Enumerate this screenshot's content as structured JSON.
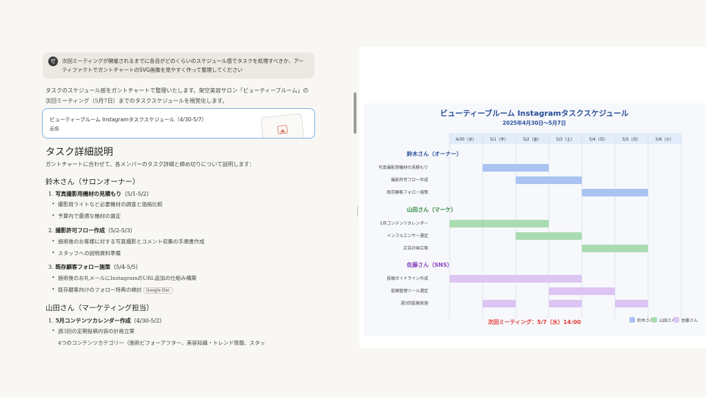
{
  "chat": {
    "user_avatar": "せ",
    "user_message": "次回ミーティングが開催されるまでに各自がどのくらいのスケジュール感でタスクを処理すべきか、アーティファクトでガントチャートのSVG画像を見やすく作って整理してください",
    "intro": "タスクのスケジュール感をガントチャートで整理いたします。架空美容サロン「ビューティーブルーム」の次回ミーティング（5月7日）までのタスクスケジュールを視覚化します。",
    "artifact_title": "ビューティーブルーム Instagramタスクスケジュール（4/30-5/7）",
    "artifact_type": "画像",
    "heading": "タスク詳細説明",
    "lead": "ガントチャートに合わせて、各メンバーのタスク詳細と締め切りについて説明します：",
    "sections": [
      {
        "title": "鈴木さん（サロンオーナー）",
        "tasks": [
          {
            "num": "1.",
            "name": "写真撮影用機材の見積もり",
            "period": "（5/1-5/2）",
            "bullets": [
              "撮影用ライトなど必要機材の調査と価格比較",
              "予算内で最適な機材の選定"
            ]
          },
          {
            "num": "2.",
            "name": "撮影許可フロー作成",
            "period": "（5/2-5/3）",
            "bullets": [
              "施術後のお客様に対する写真撮影とコメント収集の手順書作成",
              "スタッフへの説明資料準備"
            ]
          },
          {
            "num": "3.",
            "name": "既存顧客フォロー施策",
            "period": "（5/4-5/5）",
            "bullets": [
              "施術後のお礼メールにInstagramのURL追加の仕組み構築",
              "既存顧客向けのフォロー特典の検討"
            ]
          }
        ]
      },
      {
        "title": "山田さん（マーケティング担当）",
        "tasks": [
          {
            "num": "1.",
            "name": "5月コンテンツカレンダー作成",
            "period": "（4/30-5/2）",
            "bullets": [
              "週3回の定期投稿内容の計画立案",
              "4つのコンテンツカテゴリー（施術ビフォーアフター、美容知識・トレンド情報、スタッ"
            ]
          }
        ]
      }
    ],
    "google_doc_tag": "Google Doc"
  },
  "chart_data": {
    "type": "gantt",
    "title": "ビューティーブルーム Instagramタスクスケジュール",
    "subtitle": "2025年4月30日〜5月7日",
    "days": [
      "4/30（水）",
      "5/1（木）",
      "5/2（金）",
      "5/3（土）",
      "5/4（日）",
      "5/5（月）",
      "5/6（火）"
    ],
    "groups": [
      {
        "name": "鈴木さん（オーナー）",
        "color": "#a9c3f2",
        "label_color": "#2a4e9a",
        "tasks": [
          {
            "name": "写真撮影用機材の見積もり",
            "spans": [
              [
                1,
                3
              ]
            ]
          },
          {
            "name": "撮影許可フロー作成",
            "spans": [
              [
                2,
                4
              ]
            ]
          },
          {
            "name": "既存顧客フォロー施策",
            "spans": [
              [
                4,
                6
              ]
            ]
          }
        ]
      },
      {
        "name": "山田さん（マーケ）",
        "color": "#a9dcb0",
        "label_color": "#2f8a3c",
        "tasks": [
          {
            "name": "5月コンテンツカレンダー",
            "spans": [
              [
                0,
                3
              ]
            ]
          },
          {
            "name": "インフルエンサー選定",
            "spans": [
              [
                2,
                4
              ]
            ]
          },
          {
            "name": "広告計画立案",
            "spans": [
              [
                4,
                6
              ]
            ]
          }
        ]
      },
      {
        "name": "佐藤さん（SNS）",
        "color": "#dcc4f3",
        "label_color": "#8a3fc0",
        "tasks": [
          {
            "name": "投稿ガイドライン作成",
            "spans": [
              [
                0,
                4
              ]
            ]
          },
          {
            "name": "投稿管理ツール選定",
            "spans": [
              [
                3,
                5
              ]
            ]
          },
          {
            "name": "週3回投稿実施",
            "spans": [
              [
                1,
                2
              ],
              [
                3,
                4
              ],
              [
                5,
                6
              ]
            ]
          }
        ]
      }
    ],
    "meeting": "次回ミーティング：5/7（水）14:00",
    "legend": [
      "鈴木さん",
      "山田さん",
      "佐藤さん"
    ],
    "meeting_color": "#e53935"
  }
}
